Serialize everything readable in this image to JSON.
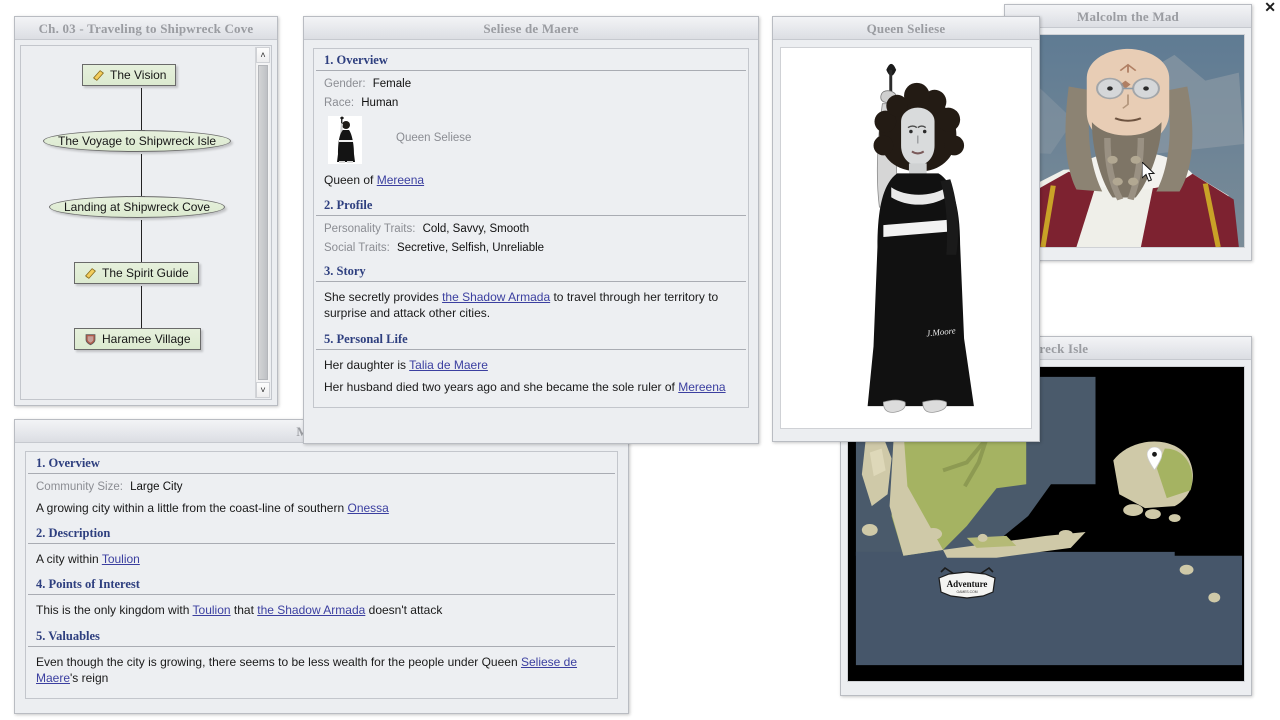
{
  "window": {
    "close_label": "✕"
  },
  "chapter_panel": {
    "title": "Ch. 03 - Traveling to Shipwreck Cove",
    "nodes": [
      {
        "label": "The Vision",
        "shape": "rect",
        "icon": "scroll-icon"
      },
      {
        "label": "The Voyage to Shipwreck Isle",
        "shape": "oval",
        "icon": "none"
      },
      {
        "label": "Landing at Shipwreck Cove",
        "shape": "oval",
        "icon": "none"
      },
      {
        "label": "The Spirit Guide",
        "shape": "rect",
        "icon": "scroll-icon"
      },
      {
        "label": "Haramee Village",
        "shape": "rect",
        "icon": "shield-icon"
      }
    ],
    "scroll": {
      "up": "˄",
      "down": "˅"
    }
  },
  "character_panel": {
    "title": "Seliese de Maere",
    "sections": [
      {
        "heading": "1. Overview"
      },
      {
        "heading": "2. Profile"
      },
      {
        "heading": "3. Story"
      },
      {
        "heading": "5. Personal Life"
      }
    ],
    "overview": {
      "gender_label": "Gender:",
      "gender_value": "Female",
      "race_label": "Race:",
      "race_value": "Human",
      "thumb_caption": "Queen Seliese",
      "title_line_prefix": "Queen of ",
      "title_line_link": "Mereena"
    },
    "profile": {
      "personality_label": "Personality Traits:",
      "personality_value": "Cold, Savvy, Smooth",
      "social_label": "Social Traits:",
      "social_value": "Secretive, Selfish, Unreliable"
    },
    "story": {
      "part1": "She secretly provides ",
      "link1": "the Shadow Armada",
      "part2": " to travel through her territory to surprise and attack other cities."
    },
    "personal_life": {
      "line1_prefix": "Her daughter is ",
      "line1_link": "Talia de Maere",
      "line2_prefix": "Her husband died two years ago and she became the sole ruler of ",
      "line2_link": "Mereena"
    }
  },
  "city_panel": {
    "title": "Mereena",
    "sections": [
      {
        "heading": "1. Overview"
      },
      {
        "heading": "2. Description"
      },
      {
        "heading": "4. Points of Interest"
      },
      {
        "heading": "5. Valuables"
      }
    ],
    "overview": {
      "size_label": "Community Size:",
      "size_value": "Large City",
      "desc_prefix": "A growing city within a little from the coast-line of southern ",
      "desc_link": "Onessa"
    },
    "description": {
      "prefix": "A city within ",
      "link": "Toulion"
    },
    "points_of_interest": {
      "p1": "This is the only kingdom with ",
      "l1": "Toulion",
      "p2": " that ",
      "l2": "the Shadow Armada",
      "p3": " doesn't attack"
    },
    "valuables": {
      "p1": "Even though the city is growing, there seems to be less wealth for the people under Queen ",
      "l1": "Seliese de Maere",
      "p2": "'s reign"
    }
  },
  "queen_image_panel": {
    "title": "Queen Seliese",
    "alt": "queen-seliese-portrait"
  },
  "malcolm_image_panel": {
    "title": "Malcolm the Mad",
    "alt": "malcolm-the-mad-portrait"
  },
  "map_panel": {
    "title": "Shipwreck Isle",
    "watermark": "Adventure",
    "markers": [
      {
        "name": "map-marker-yellow",
        "color": "#f2e43a"
      },
      {
        "name": "map-marker-white",
        "color": "#ffffff"
      }
    ]
  }
}
